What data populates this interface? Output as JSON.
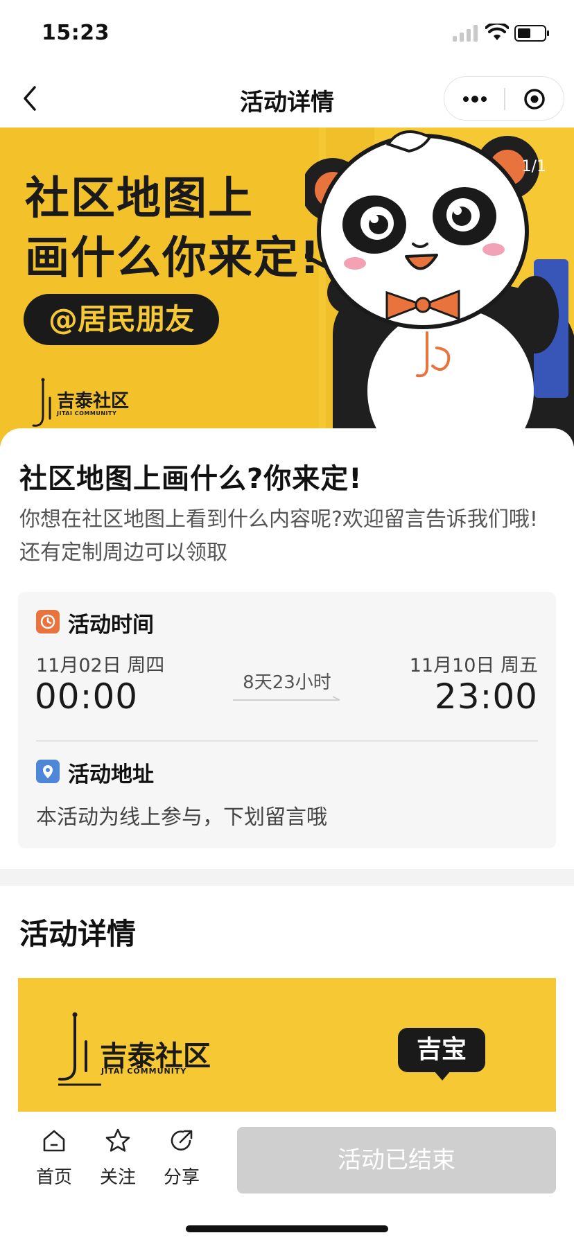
{
  "status_bar": {
    "time": "15:23"
  },
  "nav": {
    "title": "活动详情"
  },
  "banner": {
    "headline_line1": "社区地图上",
    "headline_line2": "画什么你来定!",
    "pill": "@居民朋友",
    "logo_text": "吉泰社区",
    "logo_sub": "JITAI COMMUNITY",
    "counter": "1/1"
  },
  "event": {
    "title": "社区地图上画什么?你来定!",
    "description": "你想在社区地图上看到什么内容呢?欢迎留言告诉我们哦!还有定制周边可以领取"
  },
  "time_section": {
    "label": "活动时间",
    "start_date": "11月02日 周四",
    "start_time": "00:00",
    "duration": "8天23小时",
    "end_date": "11月10日 周五",
    "end_time": "23:00"
  },
  "address_section": {
    "label": "活动地址",
    "text": "本活动为线上参与，下划留言哦"
  },
  "details": {
    "title": "活动详情",
    "logo_text": "吉泰社区",
    "logo_sub": "JITAI COMMUNITY",
    "badge": "吉宝"
  },
  "bottom_bar": {
    "home_label": "首页",
    "follow_label": "关注",
    "share_label": "分享",
    "action_label": "活动已结束"
  },
  "colors": {
    "banner_yellow": "#f5c834",
    "clock_orange": "#e9733c",
    "pin_blue": "#4e86d8",
    "disabled_gray": "#cfcfcf"
  }
}
